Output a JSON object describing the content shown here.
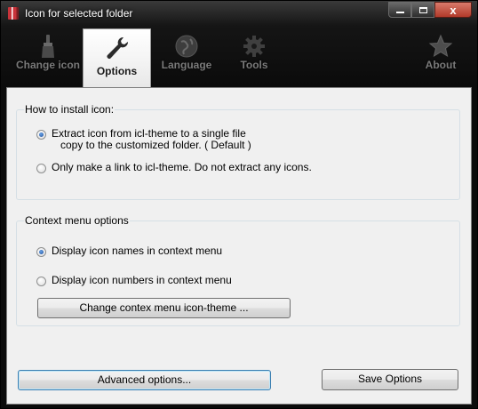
{
  "window": {
    "title": "Icon for selected folder",
    "controls": {
      "minimize": "",
      "maximize": "",
      "close": "x"
    }
  },
  "toolbar": {
    "tabs": [
      {
        "label": "Change icon",
        "icon": "brush-icon",
        "active": false
      },
      {
        "label": "Options",
        "icon": "wrench-icon",
        "active": true
      },
      {
        "label": "Language",
        "icon": "globe-icon",
        "active": false
      },
      {
        "label": "Tools",
        "icon": "gear-icon",
        "active": false
      },
      {
        "label": "About",
        "icon": "star-icon",
        "active": false
      }
    ]
  },
  "install_group": {
    "title": "How to install icon:",
    "option1_line1": "Extract icon from icl-theme to a single file",
    "option1_line2": "copy to the customized folder. ( Default )",
    "option1_checked": true,
    "option2": "Only make a link to icl-theme. Do not extract any icons.",
    "option2_checked": false
  },
  "context_group": {
    "title": "Context menu options",
    "option1": "Display icon names in context menu",
    "option1_checked": true,
    "option2": "Display icon numbers in context menu",
    "option2_checked": false,
    "change_button": "Change contex menu icon-theme ..."
  },
  "footer": {
    "advanced_button": "Advanced options...",
    "save_button": "Save Options"
  },
  "colors": {
    "accent_radio": "#1d4f9c",
    "title_bar": "#151515",
    "panel": "#f0f0f0"
  }
}
